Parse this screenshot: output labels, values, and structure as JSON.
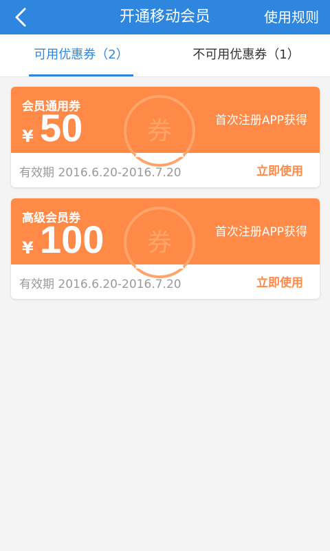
{
  "header": {
    "title": "开通移动会员",
    "rules_label": "使用规则",
    "bg_color": "#2e86de"
  },
  "tabs": [
    {
      "label": "可用优惠券（2）",
      "active": true
    },
    {
      "label": "不可用优惠券（1）",
      "active": false
    }
  ],
  "coupons": [
    {
      "name": "会员通用券",
      "currency": "¥",
      "amount": "50",
      "source": "首次注册APP获得",
      "validity": "有效期  2016.6.20-2016.7.20",
      "action": "立即使用",
      "watermark": "券"
    },
    {
      "name": "高级会员券",
      "currency": "¥",
      "amount": "100",
      "source": "首次注册APP获得",
      "validity": "有效期  2016.6.20-2016.7.20",
      "action": "立即使用",
      "watermark": "券"
    }
  ],
  "colors": {
    "accent": "#2e86de",
    "coupon": "#ff8a47",
    "muted_text": "#9a9a9a"
  }
}
